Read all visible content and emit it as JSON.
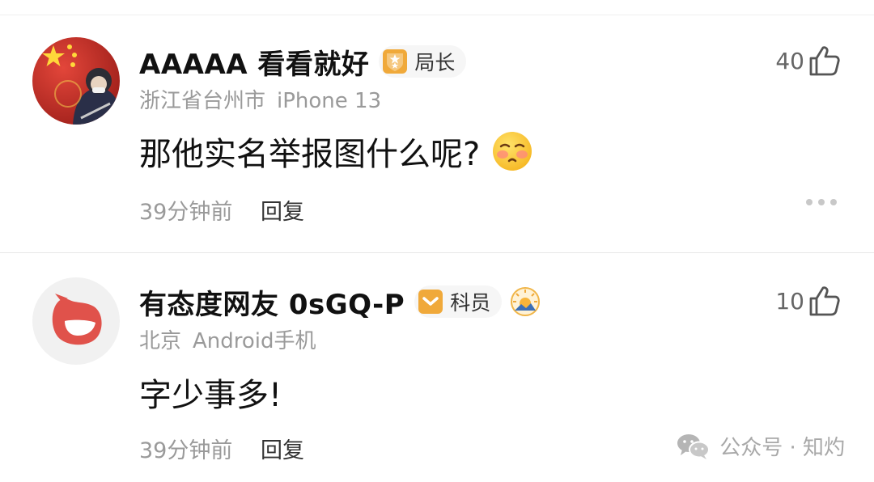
{
  "comments": [
    {
      "username": "AAAAA 看看就好",
      "badge": "局长",
      "badge_icon": "badge-shield-stars-icon",
      "location": "浙江省台州市",
      "device": "iPhone 13",
      "content": "那他实名举报图什么呢?",
      "emoji": "blush-emoji",
      "time": "39分钟前",
      "reply_label": "回复",
      "like_count": "40",
      "more_menu": true
    },
    {
      "username": "有态度网友 0sGQ-P",
      "badge": "科员",
      "badge_icon": "badge-shield-chevron-icon",
      "extra_icon": "sunrise-medal-icon",
      "location": "北京",
      "device": "Android手机",
      "content": "字少事多!",
      "time": "39分钟前",
      "reply_label": "回复",
      "like_count": "10"
    }
  ],
  "watermark": {
    "text": "公众号 · 知灼",
    "icon": "wechat-icon"
  },
  "colors": {
    "badge_gold": "#f0a93a",
    "meta_gray": "#9a9a9a",
    "avatar_red": "#d8342a"
  }
}
